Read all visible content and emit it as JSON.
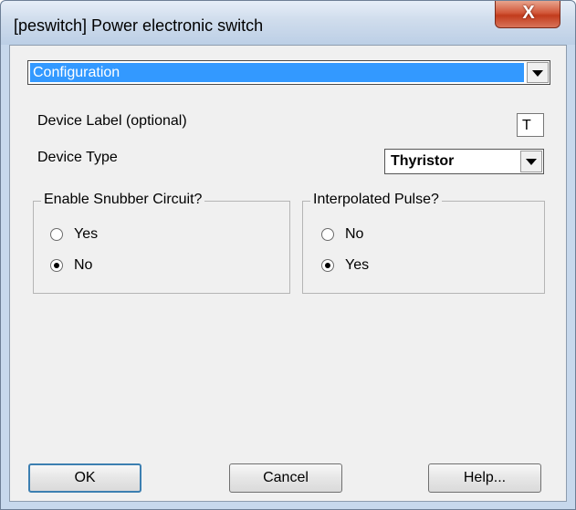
{
  "window": {
    "title": "[peswitch] Power electronic switch",
    "close_label": "X"
  },
  "section_select": {
    "value": "Configuration"
  },
  "fields": {
    "device_label": {
      "label": "Device Label (optional)",
      "value": "T"
    },
    "device_type": {
      "label": "Device Type",
      "value": "Thyristor"
    }
  },
  "snubber_group": {
    "title": "Enable Snubber Circuit?",
    "options": [
      {
        "label": "Yes",
        "checked": false
      },
      {
        "label": "No",
        "checked": true
      }
    ]
  },
  "pulse_group": {
    "title": "Interpolated Pulse?",
    "options": [
      {
        "label": "No",
        "checked": false
      },
      {
        "label": "Yes",
        "checked": true
      }
    ]
  },
  "buttons": {
    "ok": "OK",
    "cancel": "Cancel",
    "help": "Help..."
  },
  "colors": {
    "selection": "#3399ff",
    "close_button": "#c23b1c",
    "frame": "#c7d8ec"
  }
}
